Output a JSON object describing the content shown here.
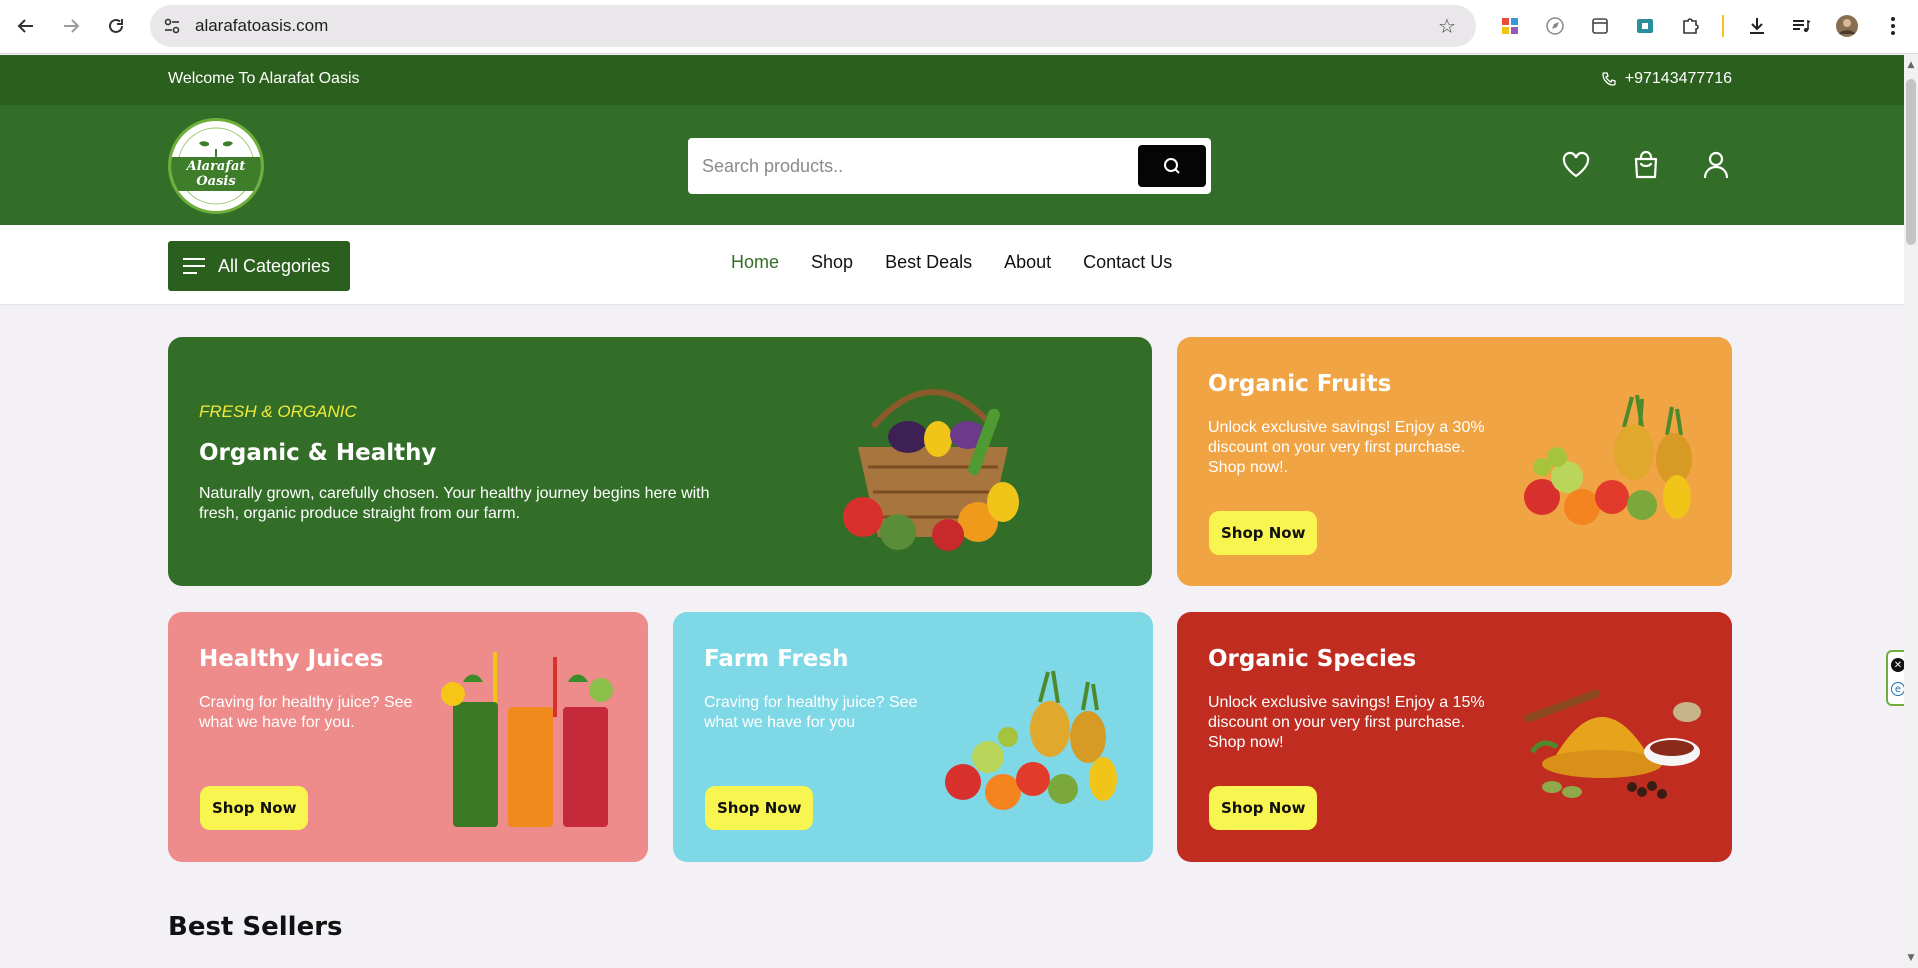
{
  "browser": {
    "url": "alarafatoasis.com"
  },
  "topbar": {
    "welcome": "Welcome To Alarafat Oasis",
    "phone": "+97143477716"
  },
  "header": {
    "logo_text": "Alarafat Oasis",
    "search_placeholder": "Search products.."
  },
  "nav": {
    "categories_label": "All Categories",
    "menu": [
      "Home",
      "Shop",
      "Best Deals",
      "About",
      "Contact Us"
    ],
    "active": "Home"
  },
  "banners": {
    "hero": {
      "eyebrow": "FRESH & ORGANIC",
      "title": "Organic & Healthy",
      "desc_line1": "Naturally grown, carefully chosen. Your healthy journey begins here with",
      "desc_line2": "fresh, organic produce straight from our farm.",
      "color": "#336e28"
    },
    "fruits": {
      "title": "Organic Fruits",
      "desc_line1": "Unlock exclusive savings! Enjoy a 30%",
      "desc_line2": "discount on your very first purchase.",
      "desc_line3": "Shop now!.",
      "button": "Shop Now",
      "color": "#f0a444"
    },
    "juices": {
      "title": "Healthy Juices",
      "desc_line1": "Craving for healthy juice? See",
      "desc_line2": "what we have for you.",
      "button": "Shop Now",
      "color": "#ee8b8b"
    },
    "farm": {
      "title": "Farm Fresh",
      "desc_line1": "Craving for healthy juice? See",
      "desc_line2": "what we have for you",
      "button": "Shop Now",
      "color": "#7fd8e6"
    },
    "species": {
      "title": "Organic Species",
      "desc_line1": "Unlock exclusive savings! Enjoy a 15%",
      "desc_line2": "discount on your very first purchase.",
      "desc_line3": "Shop now!",
      "button": "Shop Now",
      "color": "#c12c21"
    }
  },
  "sections": {
    "best_sellers": "Best Sellers"
  },
  "colors": {
    "brand_dark": "#2b5f1e",
    "brand": "#336e28",
    "button_yellow": "#f9f550"
  }
}
